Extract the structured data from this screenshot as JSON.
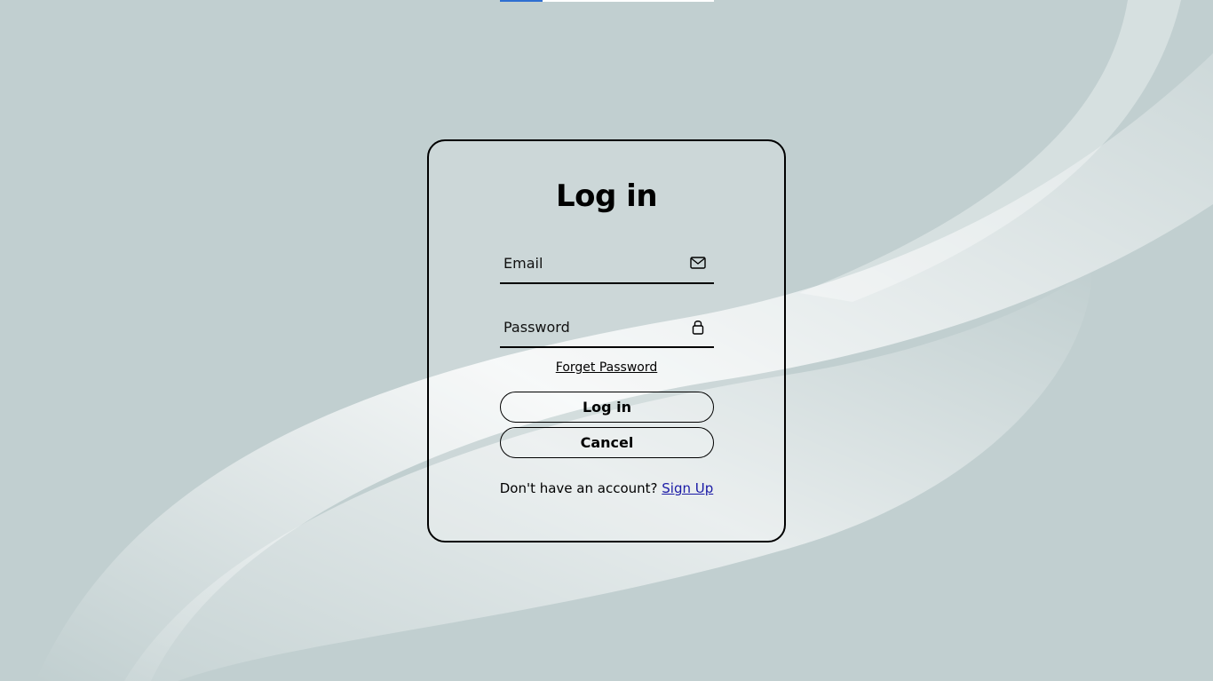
{
  "progress": {
    "fraction": 0.2,
    "fill_color": "#2f6fd1"
  },
  "login_form": {
    "title": "Log in",
    "email_placeholder": "Email",
    "password_placeholder": "Password",
    "forgot_password_link": "Forget Password",
    "login_button": "Log in",
    "cancel_button": "Cancel",
    "signup_prompt": "Don't have an account?",
    "signup_link": "Sign Up"
  },
  "icons": {
    "email": "mail-icon",
    "password": "lock-icon"
  },
  "colors": {
    "background": "#c1cfd0",
    "card_border": "#000000",
    "link": "#1a1aa6"
  }
}
